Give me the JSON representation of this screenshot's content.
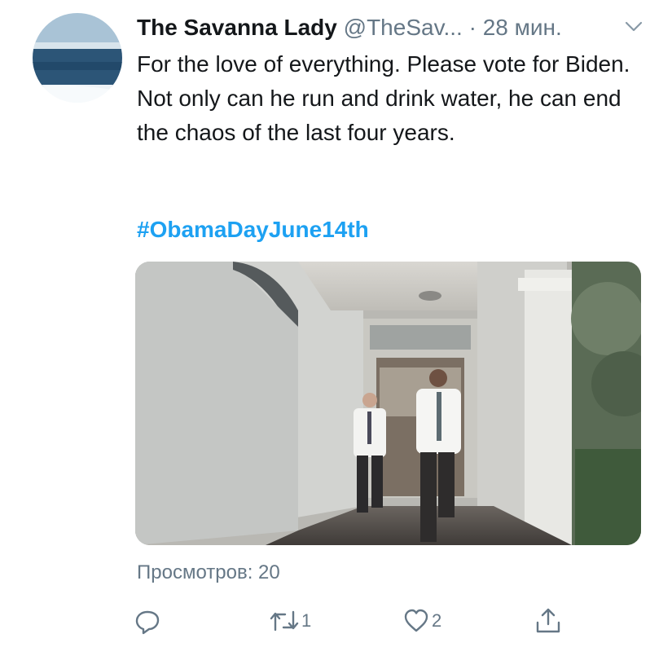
{
  "tweet": {
    "author_name": "The Savanna Lady",
    "handle": "@TheSav...",
    "separator": "·",
    "time": "28 мин.",
    "text": "For the love of everything. Please vote for Biden. Not only can he run and drink water, he can end the chaos of the last four years.",
    "hashtag": "#ObamaDayJune14th",
    "views": "Просмотров: 20"
  },
  "actions": {
    "reply_count": "",
    "retweet_count": "1",
    "like_count": "2",
    "share_count": ""
  },
  "icons": {
    "more": "chevron-down-icon",
    "reply": "reply-icon",
    "retweet": "retweet-icon",
    "like": "heart-icon",
    "share": "share-icon"
  },
  "colors": {
    "text": "#14171a",
    "muted": "#657786",
    "link": "#1da1f2",
    "background": "#ffffff"
  }
}
